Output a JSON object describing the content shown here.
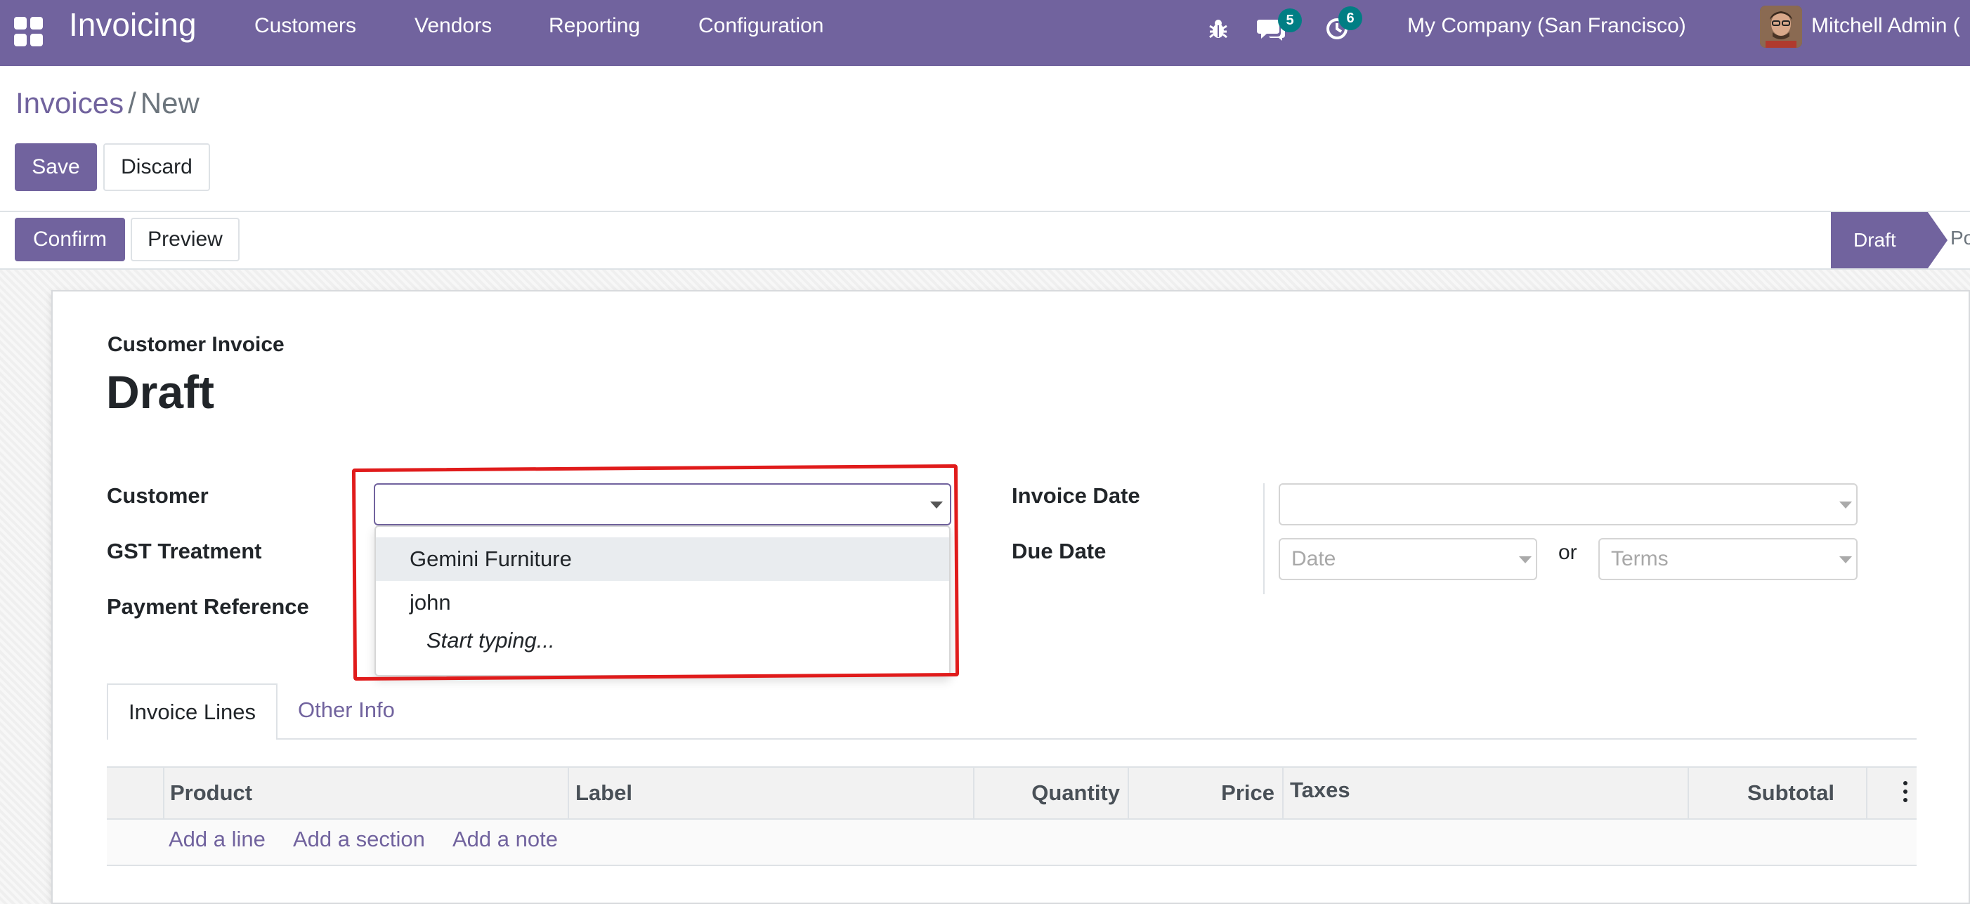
{
  "navbar": {
    "app_name": "Invoicing",
    "menu": [
      "Customers",
      "Vendors",
      "Reporting",
      "Configuration"
    ],
    "messages_count": "5",
    "activities_count": "6",
    "company": "My Company (San Francisco)",
    "user": "Mitchell Admin (",
    "icons": [
      "apps-icon",
      "bug-icon",
      "chat-icon",
      "clock-icon",
      "avatar"
    ]
  },
  "breadcrumb": {
    "parent": "Invoices",
    "separator": "/",
    "current": "New"
  },
  "actions": {
    "save": "Save",
    "discard": "Discard",
    "confirm": "Confirm",
    "preview": "Preview"
  },
  "statusbar": {
    "current": "Draft",
    "next": "Po"
  },
  "form": {
    "doc_type": "Customer Invoice",
    "title": "Draft",
    "labels": {
      "customer": "Customer",
      "gst_treatment": "GST Treatment",
      "payment_reference": "Payment Reference",
      "invoice_date": "Invoice Date",
      "due_date": "Due Date"
    },
    "customer_value": "",
    "due_date_placeholder": "Date",
    "or_label": "or",
    "terms_placeholder": "Terms"
  },
  "customer_dropdown": {
    "options": [
      "Gemini Furniture",
      "john"
    ],
    "hint": "Start typing...",
    "highlighted_index": 0
  },
  "tabs": {
    "invoice_lines": "Invoice Lines",
    "other_info": "Other Info"
  },
  "lines_table": {
    "columns": [
      "Product",
      "Label",
      "Quantity",
      "Price",
      "Taxes",
      "Subtotal"
    ],
    "add_line": "Add a line",
    "add_section": "Add a section",
    "add_note": "Add a note"
  },
  "colors": {
    "brand": "#71639e",
    "badge": "#017e84",
    "annotation": "#e01b1b"
  }
}
